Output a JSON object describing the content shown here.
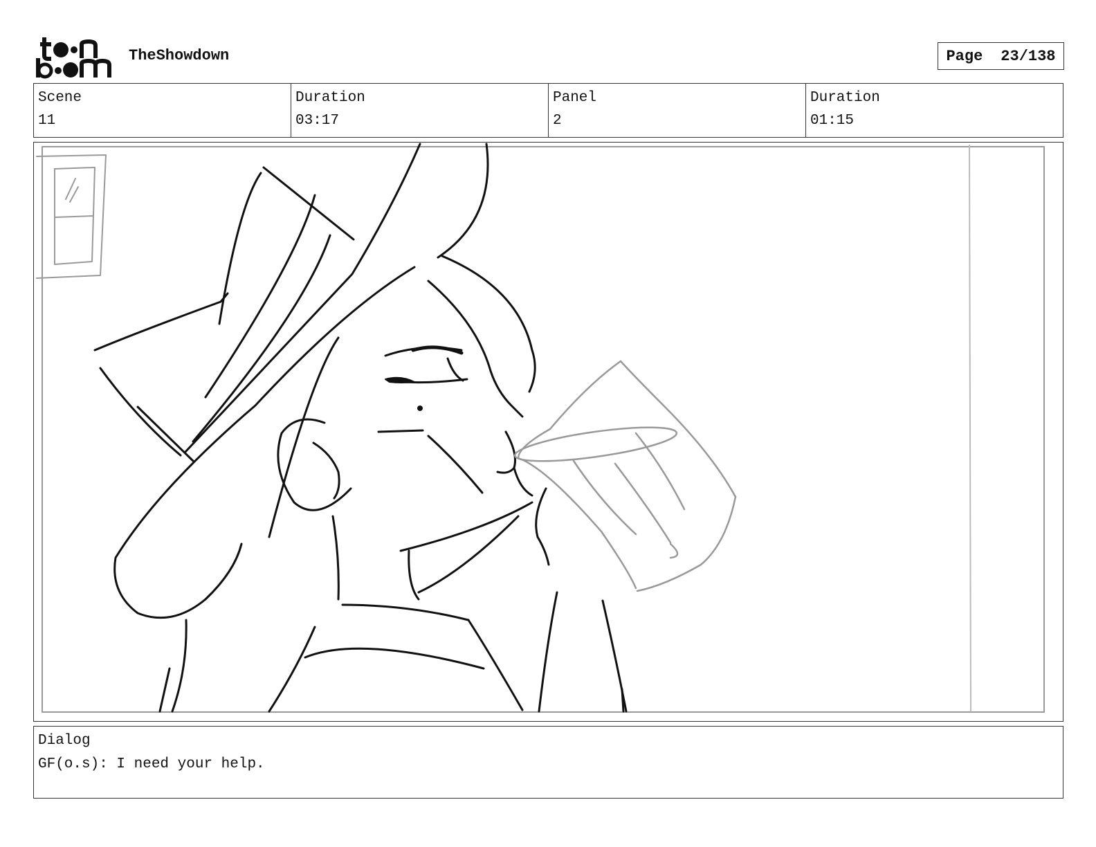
{
  "header": {
    "logo_text": "toon boom",
    "project_title": "TheShowdown",
    "page_label": "Page",
    "page_number": "23/138"
  },
  "info": {
    "scene_label": "Scene",
    "scene_value": "11",
    "scene_duration_label": "Duration",
    "scene_duration_value": "03:17",
    "panel_label": "Panel",
    "panel_value": "2",
    "panel_duration_label": "Duration",
    "panel_duration_value": "01:15"
  },
  "dialog": {
    "label": "Dialog",
    "text": "GF(o.s): I need your help."
  }
}
